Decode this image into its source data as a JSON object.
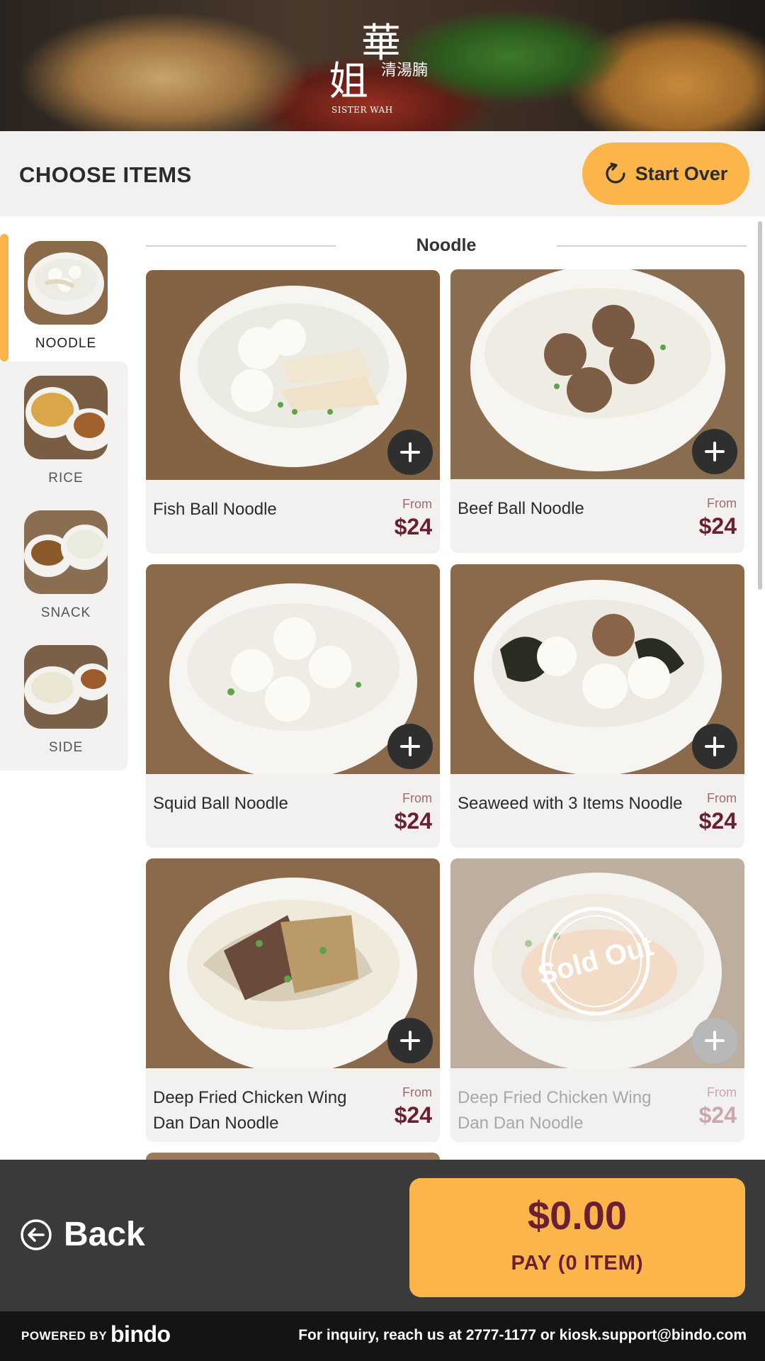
{
  "hero": {
    "logo_chars": "華姐清湯腩",
    "logo_name": "Sister Wah"
  },
  "header": {
    "title": "CHOOSE ITEMS",
    "start_over_label": "Start Over"
  },
  "categories": [
    {
      "label": "NOODLE",
      "active": true
    },
    {
      "label": "RICE",
      "active": false
    },
    {
      "label": "SNACK",
      "active": false
    },
    {
      "label": "SIDE",
      "active": false
    }
  ],
  "section": {
    "title": "Noodle"
  },
  "products": [
    {
      "name": "Fish Ball Noodle",
      "from": "From",
      "price": "$24",
      "sold_out": false
    },
    {
      "name": "Beef Ball Noodle",
      "from": "From",
      "price": "$24",
      "sold_out": false
    },
    {
      "name": "Squid Ball Noodle",
      "from": "From",
      "price": "$24",
      "sold_out": false
    },
    {
      "name": "Seaweed with 3 Items Noodle",
      "from": "From",
      "price": "$24",
      "sold_out": false
    },
    {
      "name": "Deep Fried Chicken Wing Dan Dan Noodle",
      "from": "From",
      "price": "$24",
      "sold_out": false
    },
    {
      "name": "Deep Fried Chicken Wing Dan Dan Noodle",
      "from": "From",
      "price": "$24",
      "sold_out": true,
      "badge": "Sold Out"
    }
  ],
  "bottom": {
    "back_label": "Back",
    "total": "$0.00",
    "pay_label": "PAY (0 ITEM)"
  },
  "footer": {
    "powered_by": "POWERED BY",
    "brand": "bindo",
    "inquiry": "For inquiry, reach us at 2777-1177 or  kiosk.support@bindo.com"
  },
  "colors": {
    "accent": "#fcb54b",
    "price": "#6b1f33",
    "bottom_bar": "#3a3a3a",
    "footer": "#141414"
  }
}
